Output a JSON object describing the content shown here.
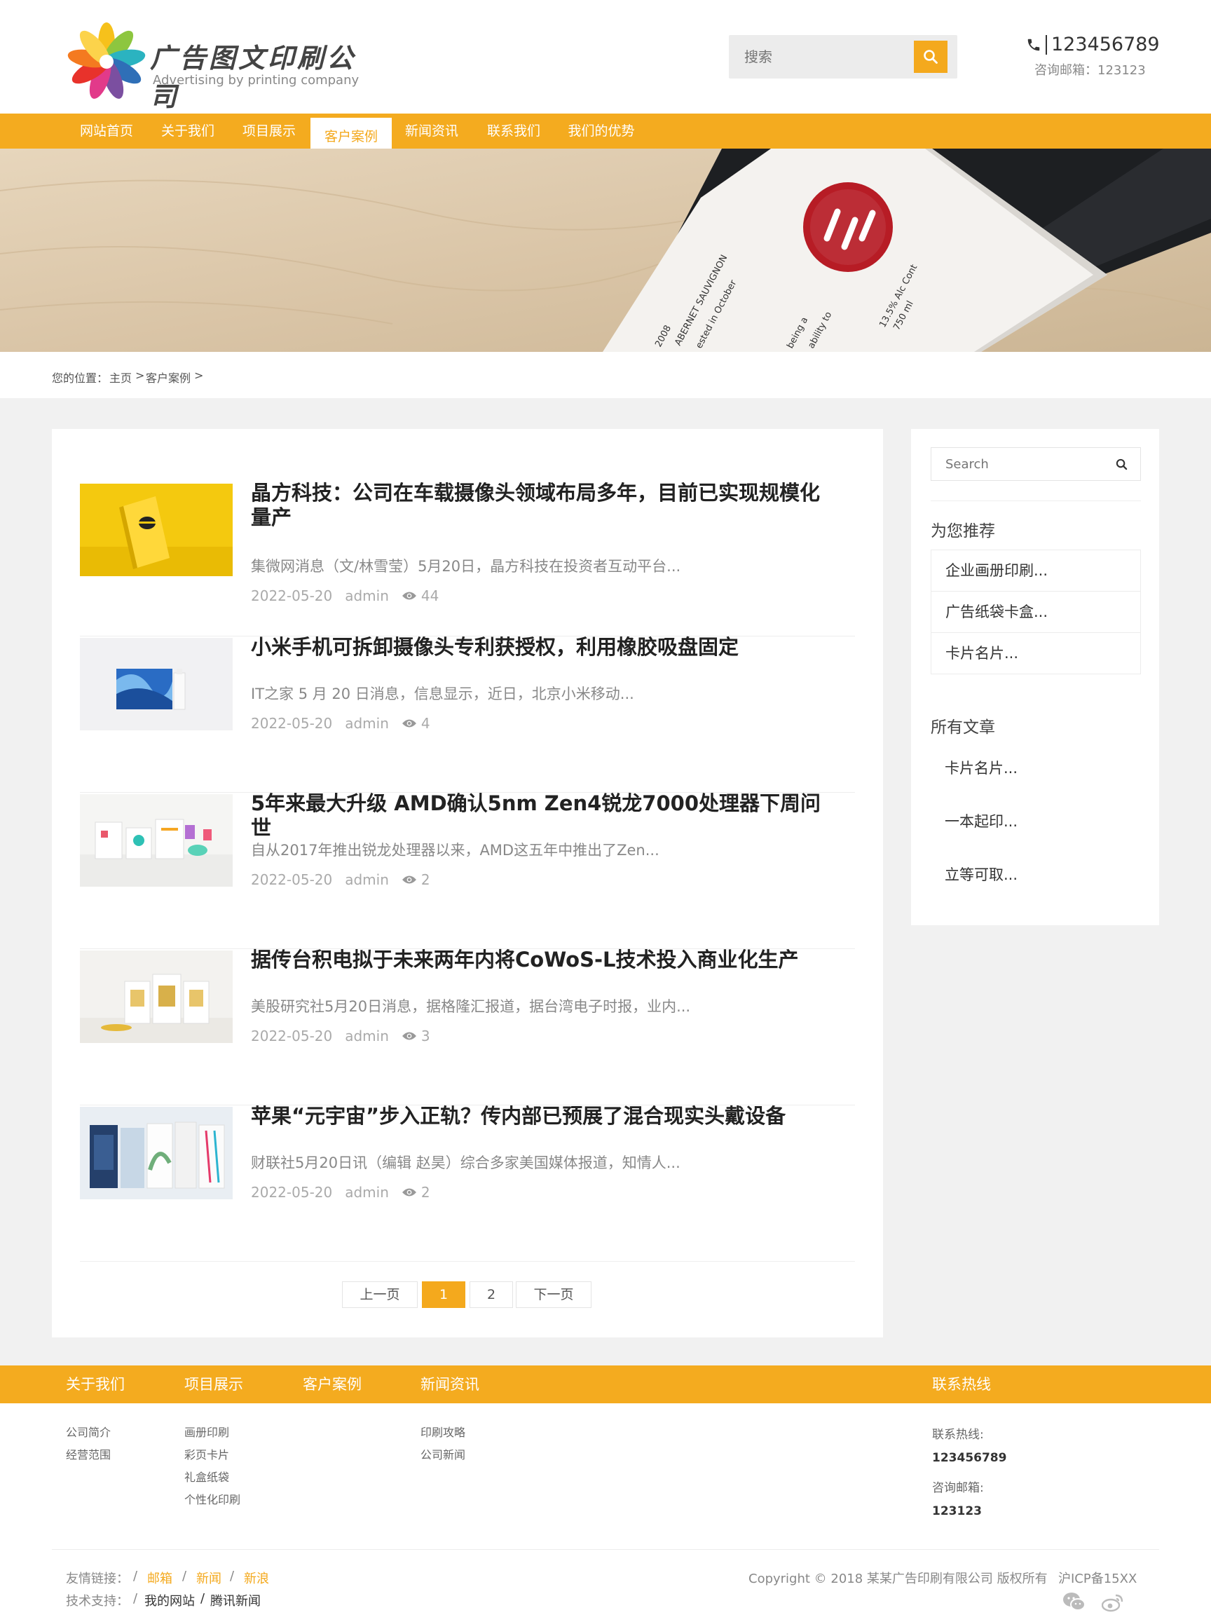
{
  "header": {
    "logo_cn": "广告图文印刷公司",
    "logo_en": "Advertising by printing company",
    "search_placeholder": "搜索",
    "phone": "123456789",
    "email_label": "咨询邮箱：123123"
  },
  "nav": [
    {
      "label": "网站首页"
    },
    {
      "label": "关于我们"
    },
    {
      "label": "项目展示"
    },
    {
      "label": "客户案例",
      "active": true
    },
    {
      "label": "新闻资讯"
    },
    {
      "label": "联系我们"
    },
    {
      "label": "我们的优势"
    }
  ],
  "banner": {
    "text_a": "2008",
    "text_b": "ABERNET SAUVIGNON",
    "text_c": "ested in October",
    "text_d": "being a",
    "text_e": "ability to",
    "text_f": "13.5% Alc Cont",
    "text_g": "750 ml"
  },
  "breadcrumb": {
    "label": "您的位置：",
    "home": "主页",
    "sep1": ">",
    "current": "客户案例",
    "sep2": ">"
  },
  "posts": [
    {
      "title": "晶方科技：公司在车载摄像头领域布局多年，目前已实现规模化量产",
      "excerpt": "集微网消息（文/林雪莹）5月20日，晶方科技在投资者互动平台...",
      "date": "2022-05-20",
      "author": "admin",
      "views": "44"
    },
    {
      "title": "小米手机可拆卸摄像头专利获授权，利用橡胶吸盘固定",
      "excerpt": "IT之家 5 月 20 日消息，信息显示，近日，北京小米移动...",
      "date": "2022-05-20",
      "author": "admin",
      "views": "4"
    },
    {
      "title": "5年来最大升级 AMD确认5nm Zen4锐龙7000处理器下周问世",
      "excerpt": "自从2017年推出锐龙处理器以来，AMD这五年中推出了Zen...",
      "date": "2022-05-20",
      "author": "admin",
      "views": "2"
    },
    {
      "title": "据传台积电拟于未来两年内将CoWoS-L技术投入商业化生产",
      "excerpt": "美股研究社5月20日消息，据格隆汇报道，据台湾电子时报，业内...",
      "date": "2022-05-20",
      "author": "admin",
      "views": "3"
    },
    {
      "title": "苹果“元宇宙”步入正轨？传内部已预展了混合现实头戴设备",
      "excerpt": "财联社5月20日讯（编辑 赵昊）综合多家美国媒体报道，知情人...",
      "date": "2022-05-20",
      "author": "admin",
      "views": "2"
    }
  ],
  "pagination": {
    "prev": "上一页",
    "p1": "1",
    "p2": "2",
    "next": "下一页"
  },
  "sidebar": {
    "search_placeholder": "Search",
    "rec_title": "为您推荐",
    "rec_items": [
      "企业画册印刷...",
      "广告纸袋卡盒...",
      "卡片名片..."
    ],
    "all_title": "所有文章",
    "all_items": [
      "卡片名片...",
      "一本起印...",
      "立等可取..."
    ]
  },
  "footer": {
    "cols": [
      "关于我们",
      "项目展示",
      "客户案例",
      "新闻资讯",
      "联系热线"
    ],
    "about": [
      "公司简介",
      "经营范围"
    ],
    "projects": [
      "画册印刷",
      "彩页卡片",
      "礼盒纸袋",
      "个性化印刷"
    ],
    "news": [
      "印刷攻略",
      "公司新闻"
    ],
    "hotline_label": "联系热线:",
    "hotline": "123456789",
    "email_label": "咨询邮箱:",
    "email": "123123",
    "friend_label": "友情链接：",
    "friend_links": [
      "邮箱",
      "新闻",
      "新浪"
    ],
    "support_label": "技术支持：",
    "support_links": [
      "我的网站",
      "腾讯新闻"
    ],
    "slash": "/",
    "copyright": "Copyright © 2018 某某广告印刷有限公司 版权所有",
    "icp": "沪ICP备15XX"
  },
  "colors": {
    "accent": "#f4a91d",
    "nav": "#f4ab1f"
  }
}
